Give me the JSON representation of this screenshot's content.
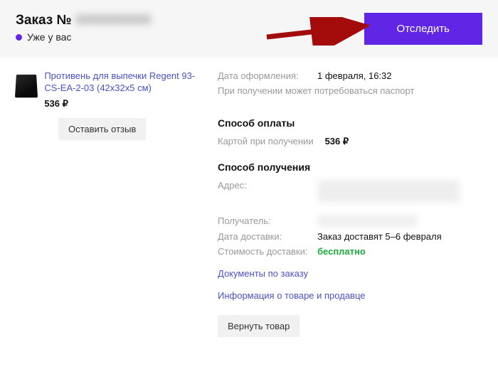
{
  "header": {
    "title_prefix": "Заказ №",
    "order_number": "0000000000",
    "status_text": "Уже у вас",
    "track_button": "Отследить"
  },
  "product": {
    "name": "Противень для выпечки Regent 93-CS-EA-2-03 (42x32x5 см)",
    "price": "536 ₽",
    "review_button": "Оставить отзыв"
  },
  "details": {
    "date_label": "Дата оформления:",
    "date_value": "1 февраля, 16:32",
    "passport_note": "При получении может потребоваться паспорт",
    "payment_title": "Способ оплаты",
    "payment_label": "Картой при получении",
    "payment_value": "536 ₽",
    "delivery_title": "Способ получения",
    "address_label": "Адрес:",
    "recipient_label": "Получатель:",
    "delivery_date_label": "Дата доставки:",
    "delivery_date_value": "Заказ доставят 5–6 февраля",
    "delivery_cost_label": "Стоимость доставки:",
    "delivery_cost_value": "бесплатно",
    "documents_link": "Документы по заказу",
    "info_link": "Информация о товаре и продавце",
    "return_button": "Вернуть товар"
  }
}
